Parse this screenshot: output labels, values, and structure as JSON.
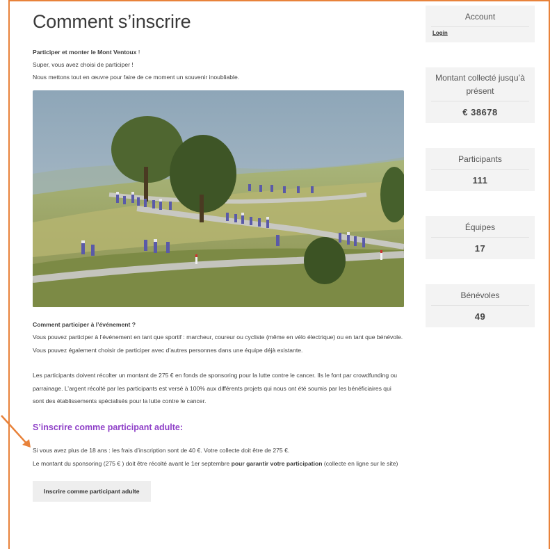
{
  "main": {
    "title": "Comment s’inscrire",
    "intro_bold": "Participer et monter le Mont Ventoux",
    "intro_bold_suffix": " !",
    "intro_line2": "Super, vous avez choisi de participer !",
    "intro_line3": "Nous mettons tout en œuvre pour faire de ce moment un souvenir inoubliable.",
    "section_question": "Comment participer à l’événement ?",
    "para1": "Vous pouvez participer à l’événement en tant que sportif : marcheur, coureur ou cycliste (même en vélo électrique) ou en tant que bénévole. Vous pouvez également choisir de participer avec d’autres personnes dans une équipe déjà existante.",
    "para2": "Les participants doivent récolter un montant de 275 € en fonds de sponsoring pour la lutte contre le cancer. Ils le font par crowdfunding ou parrainage. L’argent récolté par les participants est versé à 100% aux différents projets qui nous ont été soumis par les bénéficiaires qui sont des établissements spécialisés pour la lutte contre le cancer.",
    "subheading": "S’inscrire comme participant adulte:",
    "para3_line1": "Si vous avez plus de 18 ans : les frais d’inscription sont de 40 €. Votre collecte doit être de 275 €.",
    "para3_line2_start": "Le montant du sponsoring (275 € ) doit être récolté avant le 1er septembre ",
    "para3_line2_bold": "pour garantir votre participation",
    "para3_line2_end": " (collecte en ligne sur le site)",
    "cta_label": "Inscrire comme participant adulte"
  },
  "sidebar": {
    "account_title": "Account",
    "login_label": "Login",
    "amount_title": "Montant collecté jusqu’à présent",
    "amount_value": "€ 38678",
    "participants_title": "Participants",
    "participants_value": "111",
    "teams_title": "Équipes",
    "teams_value": "17",
    "volunteers_title": "Bénévoles",
    "volunteers_value": "49"
  },
  "colors": {
    "annotation": "#e8823a",
    "subheading": "#8e3fc7",
    "widget_bg": "#f3f3f3"
  }
}
